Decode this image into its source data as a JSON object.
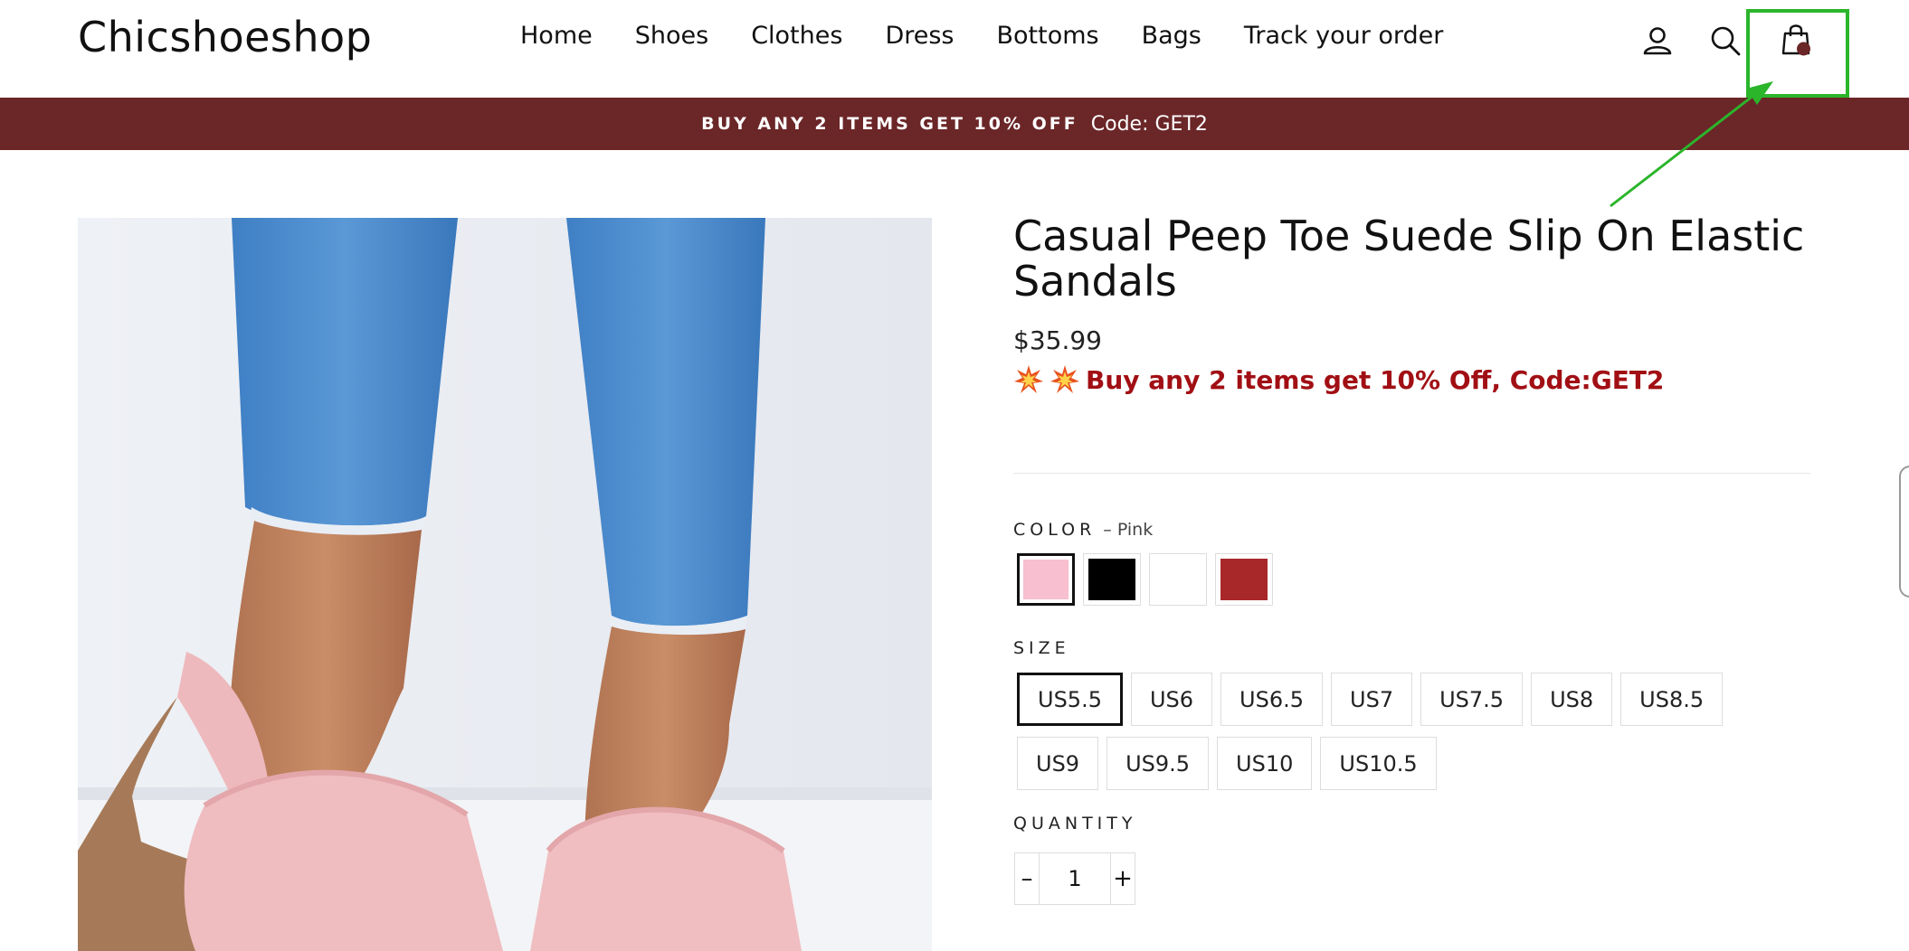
{
  "header": {
    "logo": "Chicshoeshop",
    "nav": [
      "Home",
      "Shoes",
      "Clothes",
      "Dress",
      "Bottoms",
      "Bags",
      "Track your order"
    ],
    "icons": [
      "user-icon",
      "search-icon",
      "cart-icon"
    ]
  },
  "promo_bar": {
    "headline": "BUY ANY 2 ITEMS GET 10% OFF",
    "code": "Code: GET2"
  },
  "product": {
    "title": "Casual Peep Toe Suede Slip On Elastic Sandals",
    "price": "$35.99",
    "promo_text": "Buy any 2 items get 10% Off, Code:GET2",
    "color_label": "COLOR",
    "selected_color": "– Pink",
    "colors": [
      {
        "name": "Pink",
        "hex": "#f7bfd0"
      },
      {
        "name": "Black",
        "hex": "#000000"
      },
      {
        "name": "White",
        "hex": "#ffffff"
      },
      {
        "name": "Red",
        "hex": "#a8282a"
      }
    ],
    "size_label": "SIZE",
    "sizes": [
      "US5.5",
      "US6",
      "US6.5",
      "US7",
      "US7.5",
      "US8",
      "US8.5",
      "US9",
      "US9.5",
      "US10",
      "US10.5"
    ],
    "selected_size": "US5.5",
    "quantity_label": "QUANTITY",
    "quantity": "1",
    "minus": "–",
    "plus": "+"
  },
  "theme": {
    "promo_bg": "#6b2628",
    "promo_text_color": "#a10f14",
    "annotation_color": "#2bb52b"
  }
}
